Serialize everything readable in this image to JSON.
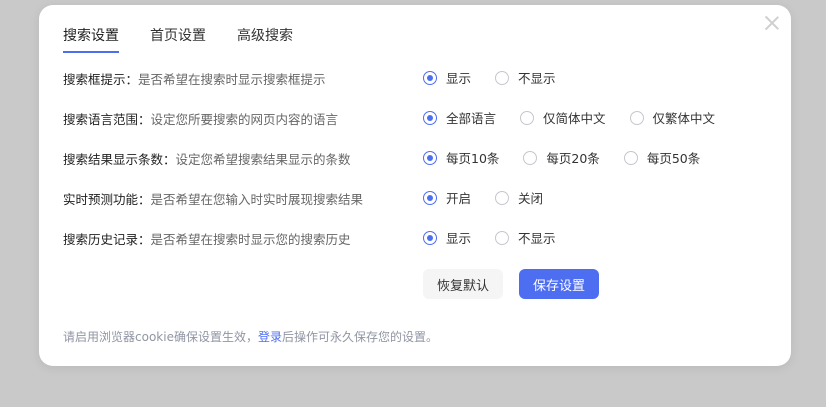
{
  "tabs": [
    {
      "label": "搜索设置",
      "active": true
    },
    {
      "label": "首页设置",
      "active": false
    },
    {
      "label": "高级搜索",
      "active": false
    }
  ],
  "settings": [
    {
      "title": "搜索框提示：",
      "desc": "是否希望在搜索时显示搜索框提示",
      "options": [
        {
          "label": "显示",
          "selected": true
        },
        {
          "label": "不显示",
          "selected": false
        }
      ]
    },
    {
      "title": "搜索语言范围：",
      "desc": "设定您所要搜索的网页内容的语言",
      "options": [
        {
          "label": "全部语言",
          "selected": true
        },
        {
          "label": "仅简体中文",
          "selected": false
        },
        {
          "label": "仅繁体中文",
          "selected": false
        }
      ]
    },
    {
      "title": "搜索结果显示条数：",
      "desc": "设定您希望搜索结果显示的条数",
      "options": [
        {
          "label": "每页10条",
          "selected": true
        },
        {
          "label": "每页20条",
          "selected": false
        },
        {
          "label": "每页50条",
          "selected": false
        }
      ]
    },
    {
      "title": "实时预测功能：",
      "desc": "是否希望在您输入时实时展现搜索结果",
      "options": [
        {
          "label": "开启",
          "selected": true
        },
        {
          "label": "关闭",
          "selected": false
        }
      ]
    },
    {
      "title": "搜索历史记录：",
      "desc": "是否希望在搜索时显示您的搜索历史",
      "options": [
        {
          "label": "显示",
          "selected": true
        },
        {
          "label": "不显示",
          "selected": false
        }
      ]
    }
  ],
  "buttons": {
    "reset": "恢复默认",
    "save": "保存设置"
  },
  "footer": {
    "before": "请启用浏览器cookie确保设置生效，",
    "link": "登录",
    "after": "后操作可永久保存您的设置。"
  },
  "colors": {
    "accent": "#4e6ef2",
    "overlay": "#c9c9c9"
  }
}
